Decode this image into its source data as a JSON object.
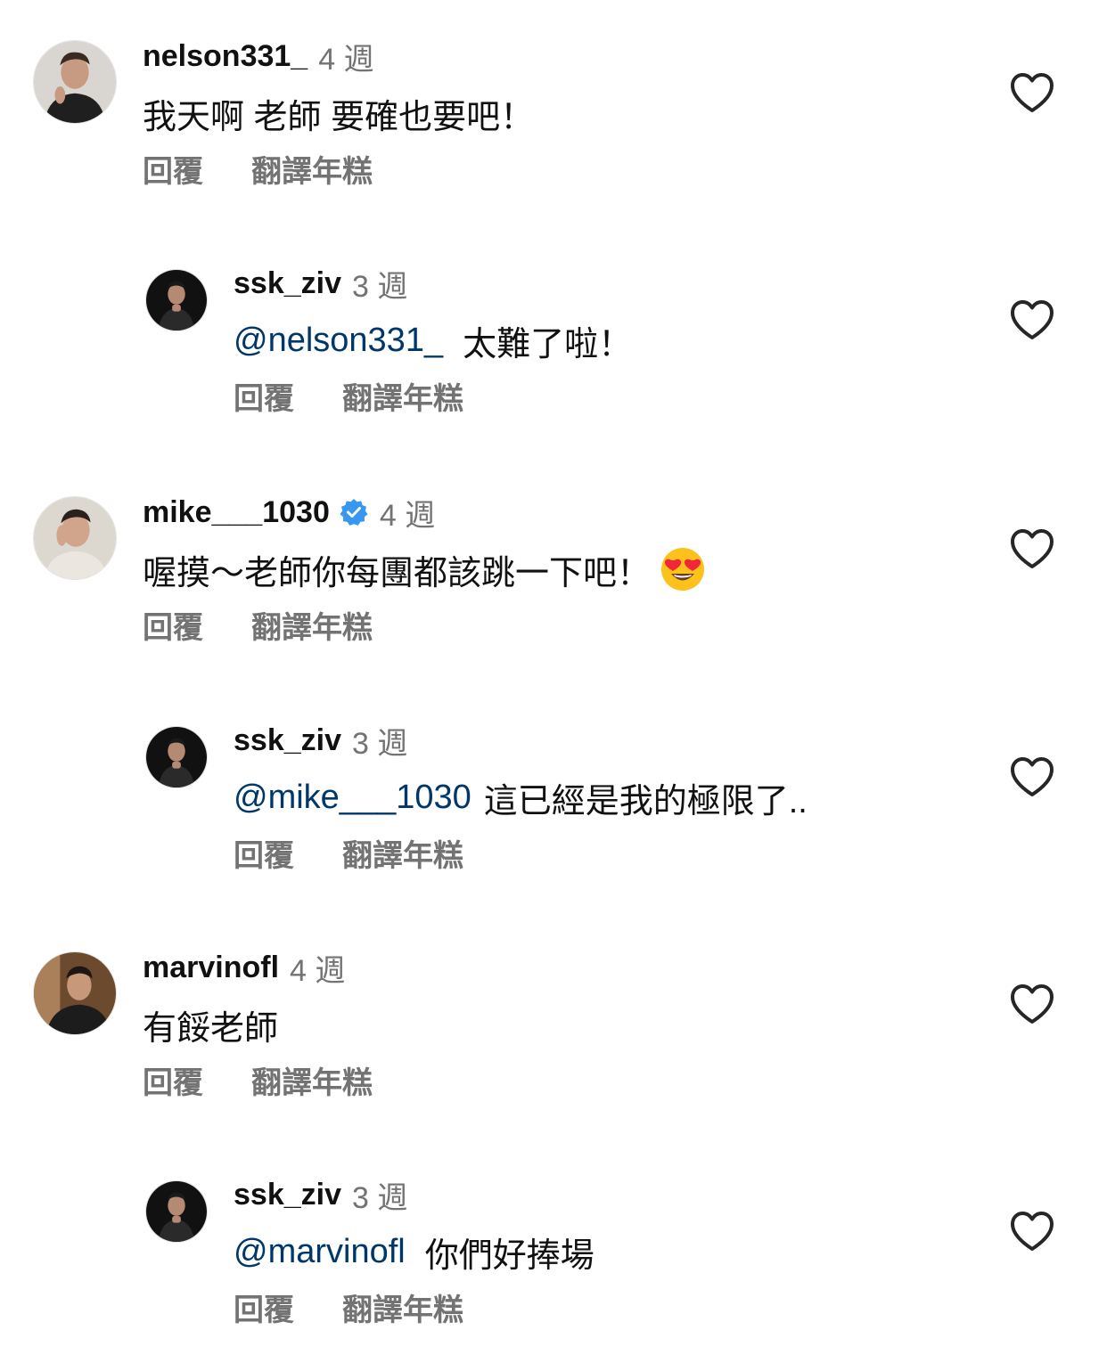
{
  "comments": [
    {
      "username": "nelson331_",
      "time": "4 週",
      "mention": "",
      "text": "我天啊 老師 要確也要吧！",
      "reply_label": "回覆",
      "translate_label": "翻譯年糕",
      "verified": false,
      "emoji": "",
      "avatar_icon": "profile-photo"
    },
    {
      "username": "ssk_ziv",
      "time": "3 週",
      "mention": "@nelson331_",
      "text": "太難了啦！",
      "reply_label": "回覆",
      "translate_label": "翻譯年糕",
      "verified": false,
      "emoji": "",
      "avatar_icon": "profile-photo"
    },
    {
      "username": "mike___1030",
      "time": "4 週",
      "mention": "",
      "text": "喔摸～老師你每團都該跳一下吧！",
      "reply_label": "回覆",
      "translate_label": "翻譯年糕",
      "verified": true,
      "emoji": "heart-eyes-emoji",
      "avatar_icon": "profile-photo"
    },
    {
      "username": "ssk_ziv",
      "time": "3 週",
      "mention": "@mike___1030",
      "text": "這已經是我的極限了..",
      "reply_label": "回覆",
      "translate_label": "翻譯年糕",
      "verified": false,
      "emoji": "",
      "avatar_icon": "profile-photo"
    },
    {
      "username": "marvinofl",
      "time": "4 週",
      "mention": "",
      "text": "有餒老師",
      "reply_label": "回覆",
      "translate_label": "翻譯年糕",
      "verified": false,
      "emoji": "",
      "avatar_icon": "profile-photo"
    },
    {
      "username": "ssk_ziv",
      "time": "3 週",
      "mention": "@marvinofl",
      "text": "你們好捧場",
      "reply_label": "回覆",
      "translate_label": "翻譯年糕",
      "verified": false,
      "emoji": "",
      "avatar_icon": "profile-photo"
    }
  ],
  "icons": {
    "like": "heart-outline-icon",
    "verified": "verified-badge-icon"
  },
  "colors": {
    "text": "#111111",
    "secondary": "#737373",
    "mention": "#00376b",
    "verified": "#3897f0",
    "background": "#ffffff"
  }
}
